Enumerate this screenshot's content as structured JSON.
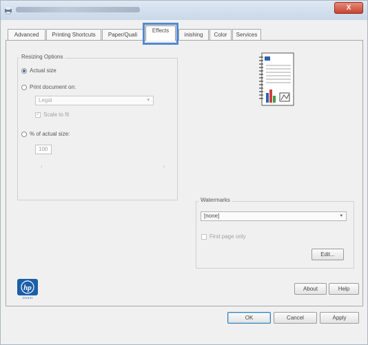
{
  "window": {
    "title": "",
    "close_label": "X"
  },
  "tabs": [
    {
      "label": "Advanced"
    },
    {
      "label": "Printing Shortcuts"
    },
    {
      "label": "Paper/Quali"
    },
    {
      "label": "Effects"
    },
    {
      "label": "inishing"
    },
    {
      "label": "Color"
    },
    {
      "label": "Services"
    }
  ],
  "resizing": {
    "legend": "Resizing Options",
    "actual_size_label": "Actual size",
    "print_document_on_label": "Print document on:",
    "paper_size_value": "Legal",
    "scale_to_fit_label": "Scale to fit",
    "percent_label": "% of actual size:",
    "percent_value": "100",
    "slider_left": "‹",
    "slider_right": "›"
  },
  "watermarks": {
    "legend": "Watermarks",
    "selected_value": "[none]",
    "first_page_only_label": "First page only",
    "edit_label": "Edit..."
  },
  "footer": {
    "about_label": "About",
    "help_label": "Help",
    "ok_label": "OK",
    "cancel_label": "Cancel",
    "apply_label": "Apply"
  },
  "brand": {
    "logo_text": "hp",
    "logo_subtext": "invent",
    "logo_color": "#1a5ea8"
  },
  "icons": {
    "chevron": "▾"
  }
}
